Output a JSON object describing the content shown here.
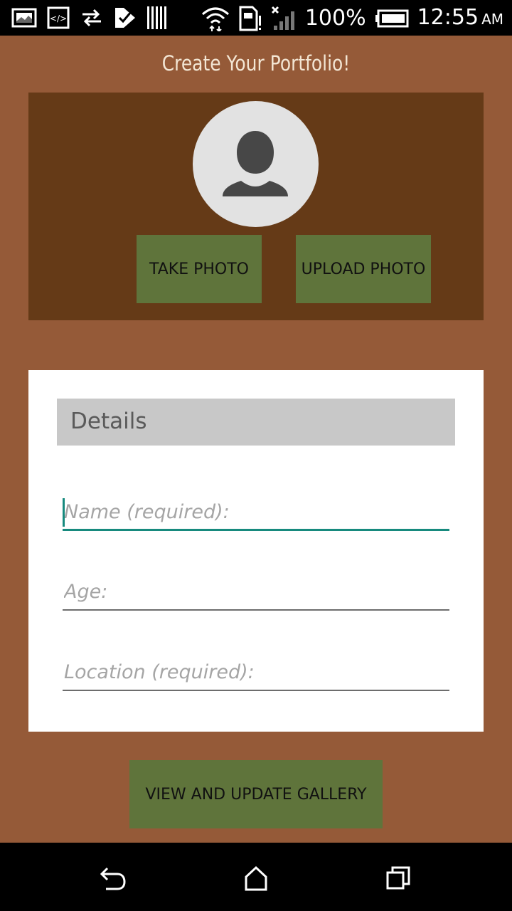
{
  "status_bar": {
    "battery_percent": "100%",
    "time": "12:55",
    "ampm": "AM",
    "icons": [
      "image-icon",
      "code-icon",
      "transfer-icon",
      "checklist-icon",
      "barcode-icon",
      "wifi-icon",
      "sim-icon",
      "signal-icon",
      "battery-icon"
    ]
  },
  "app": {
    "title": "Create Your Portfolio!",
    "photo": {
      "avatar_icon": "person-icon",
      "take_photo_label": "TAKE PHOTO",
      "upload_photo_label": "UPLOAD PHOTO"
    },
    "details": {
      "header": "Details",
      "fields": [
        {
          "placeholder": "Name (required):",
          "value": ""
        },
        {
          "placeholder": "Age:",
          "value": ""
        },
        {
          "placeholder": "Location (required):",
          "value": ""
        }
      ]
    },
    "gallery_button_label": "VIEW AND UPDATE GALLERY"
  },
  "nav_bar": {
    "icons": [
      "back-icon",
      "home-icon",
      "recent-apps-icon"
    ]
  },
  "colors": {
    "background": "#955a38",
    "photo_panel": "#653a17",
    "button": "#5f743b",
    "accent": "#178a7e"
  }
}
